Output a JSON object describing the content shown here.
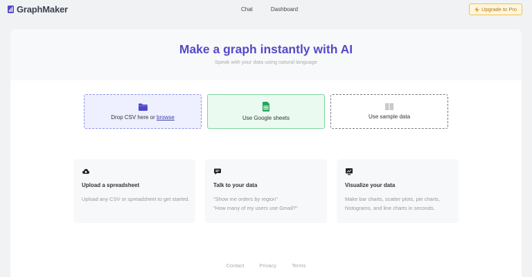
{
  "app": {
    "name": "GraphMaker"
  },
  "nav": {
    "links": [
      "Chat",
      "Dashboard"
    ],
    "upgrade_label": "Upgrade to Pro"
  },
  "hero": {
    "title": "Make a graph instantly with AI",
    "subtitle": "Speak with your data using natural language"
  },
  "options": {
    "csv": {
      "label": "Drop CSV here or ",
      "link": "browse",
      "icon": "folder-icon"
    },
    "sheets": {
      "label": "Use Google sheets",
      "icon": "google-sheets-icon"
    },
    "sample": {
      "label": "Use sample data",
      "icon": "sample-data-icon"
    }
  },
  "features": [
    {
      "icon": "cloud-upload-icon",
      "title": "Upload a spreadsheet",
      "desc": "Upload any CSV or spreadsheet to get started."
    },
    {
      "icon": "chat-icon",
      "title": "Talk to your data",
      "desc": "\"Show me orders by region\"\n\"How many of my users use Gmail?\""
    },
    {
      "icon": "chart-icon",
      "title": "Visualize your data",
      "desc": "Make bar charts, scatter plots, pie charts, histograms, and line charts in seconds."
    }
  ],
  "footer": {
    "links": [
      "Contact",
      "Privacy",
      "Terms"
    ]
  },
  "colors": {
    "accent": "#5549c8",
    "upgrade": "#b8750d",
    "sheets": "#22a55a"
  }
}
